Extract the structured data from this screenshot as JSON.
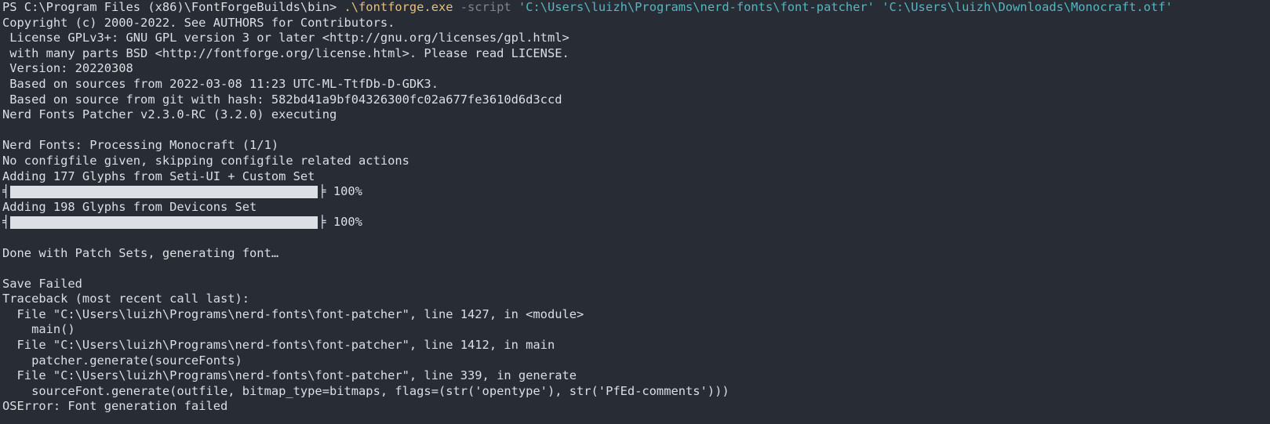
{
  "command": {
    "prompt": "PS C:\\Program Files (x86)\\FontForgeBuilds\\bin> ",
    "exe": ".\\fontforge.exe",
    "flag": " -script ",
    "arg1": "'C:\\Users\\luizh\\Programs\\nerd-fonts\\font-patcher'",
    "arg2": " 'C:\\Users\\luizh\\Downloads\\Monocraft.otf'"
  },
  "output": {
    "l1": "Copyright (c) 2000-2022. See AUTHORS for Contributors.",
    "l2": " License GPLv3+: GNU GPL version 3 or later <http://gnu.org/licenses/gpl.html>",
    "l3": " with many parts BSD <http://fontforge.org/license.html>. Please read LICENSE.",
    "l4": " Version: 20220308",
    "l5": " Based on sources from 2022-03-08 11:23 UTC-ML-TtfDb-D-GDK3.",
    "l6": " Based on source from git with hash: 582bd41a9bf04326300fc02a677fe3610d6d3ccd",
    "l7": "Nerd Fonts Patcher v2.3.0-RC (3.2.0) executing",
    "l8": "Nerd Fonts: Processing Monocraft (1/1)",
    "l9": "No configfile given, skipping configfile related actions",
    "l10": "Adding 177 Glyphs from Seti-UI + Custom Set",
    "l11": "Adding 198 Glyphs from Devicons Set",
    "l12": "Done with Patch Sets, generating font…",
    "l13": "Save Failed",
    "l14": "Traceback (most recent call last):",
    "l15": "  File \"C:\\Users\\luizh\\Programs\\nerd-fonts\\font-patcher\", line 1427, in <module>",
    "l16": "    main()",
    "l17": "  File \"C:\\Users\\luizh\\Programs\\nerd-fonts\\font-patcher\", line 1412, in main",
    "l18": "    patcher.generate(sourceFonts)",
    "l19": "  File \"C:\\Users\\luizh\\Programs\\nerd-fonts\\font-patcher\", line 339, in generate",
    "l20": "    sourceFont.generate(outfile, bitmap_type=bitmaps, flags=(str('opentype'), str('PfEd-comments')))",
    "l21": "OSError: Font generation failed"
  },
  "progress": [
    {
      "left": "╡",
      "right": "╞",
      "percent_text": " 100%",
      "value": 1.0
    },
    {
      "left": "╡",
      "right": "╞",
      "percent_text": " 100%",
      "value": 1.0
    }
  ],
  "colors": {
    "background": "#282c34",
    "foreground": "#dcdfe4",
    "command": "#e5c07b",
    "parameter": "#7f848e",
    "string": "#56b6c2"
  }
}
